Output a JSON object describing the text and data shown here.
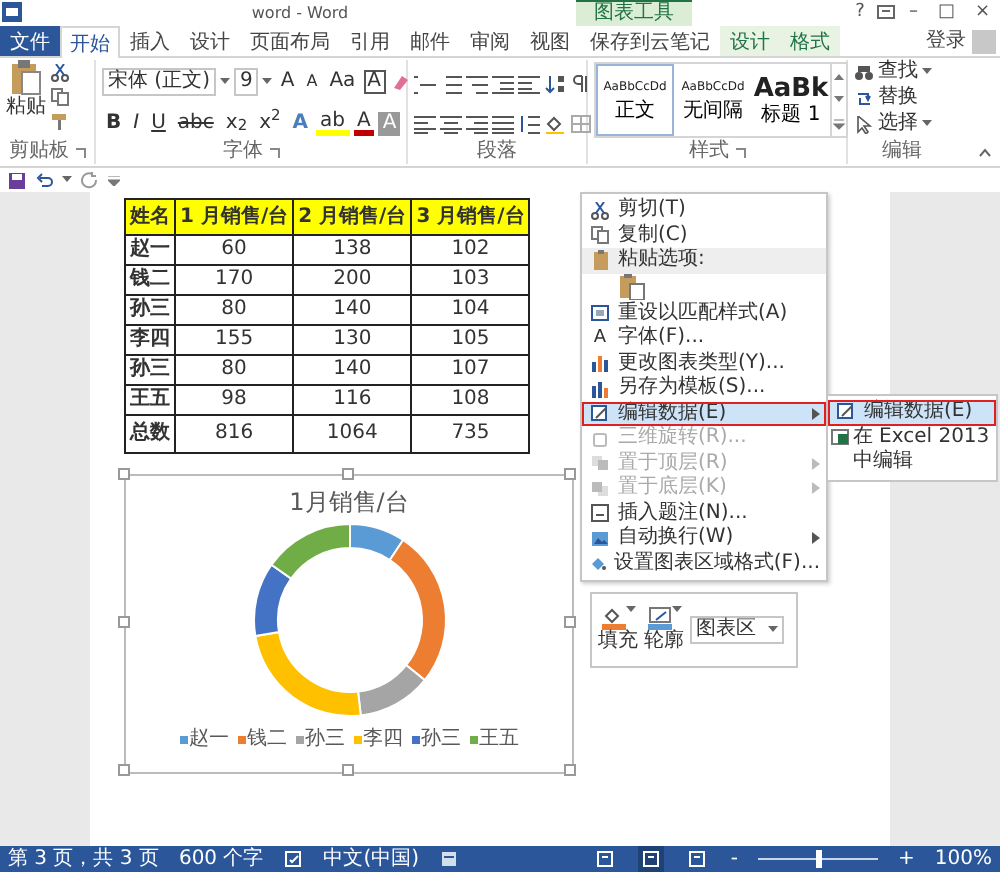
{
  "window": {
    "title": "word - Word",
    "contextual_group": "图表工具",
    "controls": [
      "?",
      "–",
      "□",
      "×"
    ],
    "account": "登录"
  },
  "tabs": [
    {
      "label": "文件",
      "kind": "file",
      "selected": false
    },
    {
      "label": "开始",
      "kind": "tab",
      "selected": true
    },
    {
      "label": "插入",
      "kind": "tab",
      "selected": false
    },
    {
      "label": "设计",
      "kind": "tab",
      "selected": false
    },
    {
      "label": "页面布局",
      "kind": "tab",
      "selected": false
    },
    {
      "label": "引用",
      "kind": "tab",
      "selected": false
    },
    {
      "label": "邮件",
      "kind": "tab",
      "selected": false
    },
    {
      "label": "审阅",
      "kind": "tab",
      "selected": false
    },
    {
      "label": "视图",
      "kind": "tab",
      "selected": false
    },
    {
      "label": "保存到云笔记",
      "kind": "tab",
      "selected": false
    },
    {
      "label": "设计",
      "kind": "contextual",
      "selected": false
    },
    {
      "label": "格式",
      "kind": "contextual",
      "selected": false
    }
  ],
  "ribbon": {
    "clipboard": {
      "paste": "粘贴",
      "label": "剪贴板"
    },
    "font": {
      "name": "宋体 (正文)",
      "size": "9",
      "label": "字体",
      "row1": [
        {
          "text": "A",
          "kind": "grow"
        },
        {
          "text": "A",
          "kind": "shrink"
        },
        {
          "text": "Aa",
          "kind": "case"
        },
        {
          "text": "A",
          "kind": "border"
        }
      ],
      "row2": [
        {
          "text": "B",
          "kind": "bold"
        },
        {
          "text": "I",
          "kind": "italic"
        },
        {
          "text": "U",
          "kind": "underline"
        },
        {
          "text": "abc",
          "kind": "strike"
        },
        {
          "text": "x$_{2}$",
          "kind": "plain"
        },
        {
          "text": "x$^{2}$",
          "kind": "plain"
        },
        {
          "text": "A",
          "kind": "effect"
        },
        {
          "text": "ab",
          "kind": "highlight"
        },
        {
          "text": "A",
          "kind": "color"
        },
        {
          "text": "A",
          "kind": "shading"
        }
      ]
    },
    "paragraph": {
      "label": "段落"
    },
    "styles": {
      "label": "样式",
      "items": [
        {
          "sample": "AaBbCcDd",
          "name": "正文",
          "kind": "body",
          "selected": true
        },
        {
          "sample": "AaBbCcDd",
          "name": "无间隔",
          "kind": "body",
          "selected": false
        },
        {
          "sample": "AaBk",
          "name": "标题 1",
          "kind": "heading",
          "selected": false
        }
      ]
    },
    "editing": {
      "label": "编辑",
      "items": [
        "查找",
        "替换",
        "选择"
      ]
    }
  },
  "table": {
    "columns": [
      "姓名",
      "1 月销售/台",
      "2 月销售/台",
      "3 月销售/台"
    ],
    "rows": [
      {
        "kind": "data",
        "cells": [
          "赵一",
          "60",
          "138",
          "102"
        ]
      },
      {
        "kind": "data",
        "cells": [
          "钱二",
          "170",
          "200",
          "103"
        ]
      },
      {
        "kind": "data",
        "cells": [
          "孙三",
          "80",
          "140",
          "104"
        ]
      },
      {
        "kind": "data",
        "cells": [
          "李四",
          "155",
          "130",
          "105"
        ]
      },
      {
        "kind": "data",
        "cells": [
          "孙三",
          "80",
          "140",
          "107"
        ]
      },
      {
        "kind": "data",
        "cells": [
          "王五",
          "98",
          "116",
          "108"
        ]
      },
      {
        "kind": "total",
        "cells": [
          "总数",
          "816",
          "1064",
          "735"
        ]
      }
    ]
  },
  "chart": {
    "title": "1月销售/台",
    "legend": [
      {
        "label": "赵一",
        "color": "#5b9bd5"
      },
      {
        "label": "钱二",
        "color": "#ed7d31"
      },
      {
        "label": "孙三",
        "color": "#a5a5a5"
      },
      {
        "label": "李四",
        "color": "#ffc000"
      },
      {
        "label": "孙三",
        "color": "#4472c4"
      },
      {
        "label": "王五",
        "color": "#70ad47"
      }
    ]
  },
  "context_menu": {
    "items": [
      {
        "kind": "item",
        "label": "剪切(T)",
        "disabled": false,
        "submenu": false,
        "highlighted": false
      },
      {
        "kind": "item",
        "label": "复制(C)",
        "disabled": false,
        "submenu": false,
        "highlighted": false
      },
      {
        "kind": "header",
        "label": "粘贴选项:",
        "disabled": false,
        "submenu": false,
        "highlighted": false
      },
      {
        "kind": "paste-option"
      },
      {
        "kind": "item",
        "label": "重设以匹配样式(A)",
        "disabled": false,
        "submenu": false,
        "highlighted": false
      },
      {
        "kind": "item",
        "glyph": "A",
        "label": "字体(F)...",
        "disabled": false,
        "submenu": false,
        "highlighted": false
      },
      {
        "kind": "item",
        "label": "更改图表类型(Y)...",
        "disabled": false,
        "submenu": false,
        "highlighted": false
      },
      {
        "kind": "item",
        "label": "另存为模板(S)...",
        "disabled": false,
        "submenu": false,
        "highlighted": false
      },
      {
        "kind": "item",
        "label": "编辑数据(E)",
        "disabled": false,
        "submenu": true,
        "highlighted": true
      },
      {
        "kind": "item",
        "label": "三维旋转(R)...",
        "disabled": true,
        "submenu": false,
        "highlighted": false
      },
      {
        "kind": "item",
        "label": "置于顶层(R)",
        "disabled": true,
        "submenu": true,
        "highlighted": false
      },
      {
        "kind": "item",
        "label": "置于底层(K)",
        "disabled": true,
        "submenu": true,
        "highlighted": false
      },
      {
        "kind": "item",
        "label": "插入题注(N)...",
        "disabled": false,
        "submenu": false,
        "highlighted": false
      },
      {
        "kind": "item",
        "label": "自动换行(W)",
        "disabled": false,
        "submenu": true,
        "highlighted": false
      },
      {
        "kind": "item",
        "label": "设置图表区域格式(F)...",
        "disabled": false,
        "submenu": false,
        "highlighted": false
      }
    ]
  },
  "submenu": {
    "items": [
      {
        "label": "编辑数据(E)",
        "highlighted": true
      },
      {
        "label": "在 Excel 2013 中编辑",
        "highlighted": false
      }
    ]
  },
  "mini_toolbar": {
    "buttons": [
      "填充",
      "轮廓"
    ],
    "dropdown": "图表区"
  },
  "status_bar": {
    "page": "第 3 页，共 3 页",
    "words": "600 个字",
    "language": "中文(中国)",
    "views": [
      {
        "selected": false
      },
      {
        "selected": true
      },
      {
        "selected": false
      }
    ],
    "zoom": {
      "minus": "-",
      "plus": "+",
      "level": 0.5,
      "text": "100%"
    }
  }
}
